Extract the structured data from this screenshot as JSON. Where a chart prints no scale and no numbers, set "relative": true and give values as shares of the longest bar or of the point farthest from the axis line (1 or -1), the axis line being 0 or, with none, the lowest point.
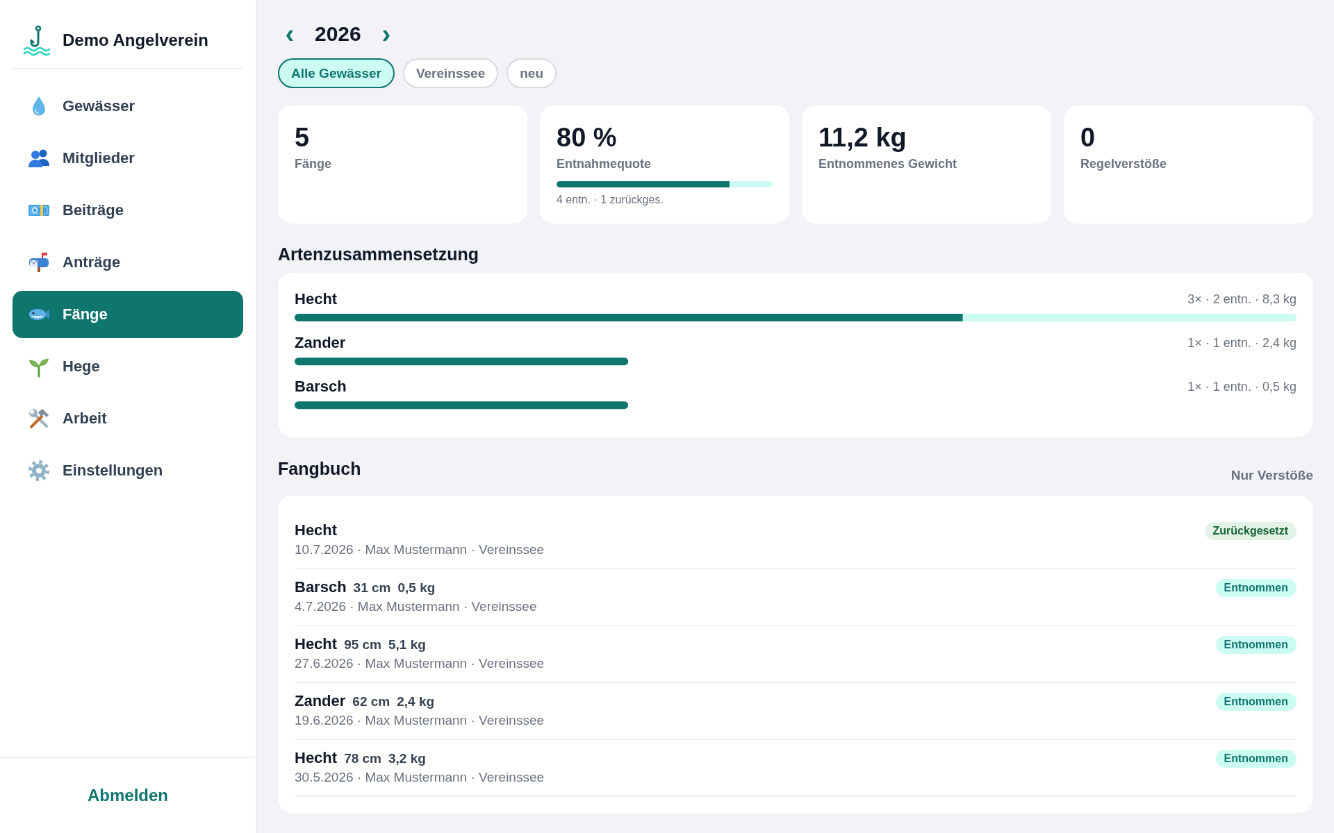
{
  "sidebar": {
    "brand": {
      "title": "Demo Angelverein"
    },
    "nav": [
      {
        "label": "Gewässer",
        "selected": false
      },
      {
        "label": "Mitglieder",
        "selected": false
      },
      {
        "label": "Beiträge",
        "selected": false
      },
      {
        "label": "Anträge",
        "selected": false
      },
      {
        "label": "Fänge",
        "selected": true
      },
      {
        "label": "Hege",
        "selected": false
      },
      {
        "label": "Arbeit",
        "selected": false
      },
      {
        "label": "Einstellungen",
        "selected": false
      }
    ],
    "logout": "Abmelden"
  },
  "year_nav": {
    "prev": "‹",
    "year": "2026",
    "next": "›"
  },
  "filters": [
    {
      "label": "Alle Gewässer",
      "selected": true
    },
    {
      "label": "Vereinssee",
      "selected": false
    },
    {
      "label": "neu",
      "selected": false
    }
  ],
  "stats": [
    {
      "kind": "number",
      "value": "5",
      "label": "Fänge"
    },
    {
      "kind": "meter",
      "value": "80 %",
      "label": "Entnahmequote",
      "level": 0.8,
      "note": "4 entn. · 1 zurückges."
    },
    {
      "kind": "number",
      "value": "11,2 kg",
      "label": "Entnommenes Gewicht"
    },
    {
      "kind": "number",
      "value": "0",
      "label": "Regelverstöße"
    }
  ],
  "species": {
    "title": "Artenzusammensetzung",
    "chart_data": {
      "type": "bar",
      "orientation": "horizontal",
      "stacked": true,
      "relative": true,
      "categories": [
        "Hecht",
        "Zander",
        "Barsch"
      ],
      "series": [
        {
          "color": "#0f766e",
          "values": [
            0.667,
            0.333,
            0.333
          ]
        },
        {
          "color": "#ccfbf1",
          "values": [
            0.333,
            0,
            0
          ]
        }
      ],
      "value_labels": [
        "3× · 2 entn. · 8,3 kg",
        "1× · 1 entn. · 2,4 kg",
        "1× · 1 entn. · 0,5 kg"
      ]
    }
  },
  "catch_log": {
    "title": "Fangbuch",
    "filter": "Nur Verstöße",
    "entries": [
      {
        "species": "Hecht",
        "meta": "10.7.2026 · Max Mustermann · Vereinssee",
        "status": {
          "kind": "released",
          "label": "Zurückgesetzt"
        }
      },
      {
        "species": "Barsch",
        "length": "31 cm",
        "weight": "0,5 kg",
        "meta": "4.7.2026 · Max Mustermann · Vereinssee",
        "status": {
          "kind": "taken",
          "label": "Entnommen"
        }
      },
      {
        "species": "Hecht",
        "length": "95 cm",
        "weight": "5,1 kg",
        "meta": "27.6.2026 · Max Mustermann · Vereinssee",
        "status": {
          "kind": "taken",
          "label": "Entnommen"
        }
      },
      {
        "species": "Zander",
        "length": "62 cm",
        "weight": "2,4 kg",
        "meta": "19.6.2026 · Max Mustermann · Vereinssee",
        "status": {
          "kind": "taken",
          "label": "Entnommen"
        }
      },
      {
        "species": "Hecht",
        "length": "78 cm",
        "weight": "3,2 kg",
        "meta": "30.5.2026 · Max Mustermann · Vereinssee",
        "status": {
          "kind": "taken",
          "label": "Entnommen"
        }
      }
    ]
  }
}
